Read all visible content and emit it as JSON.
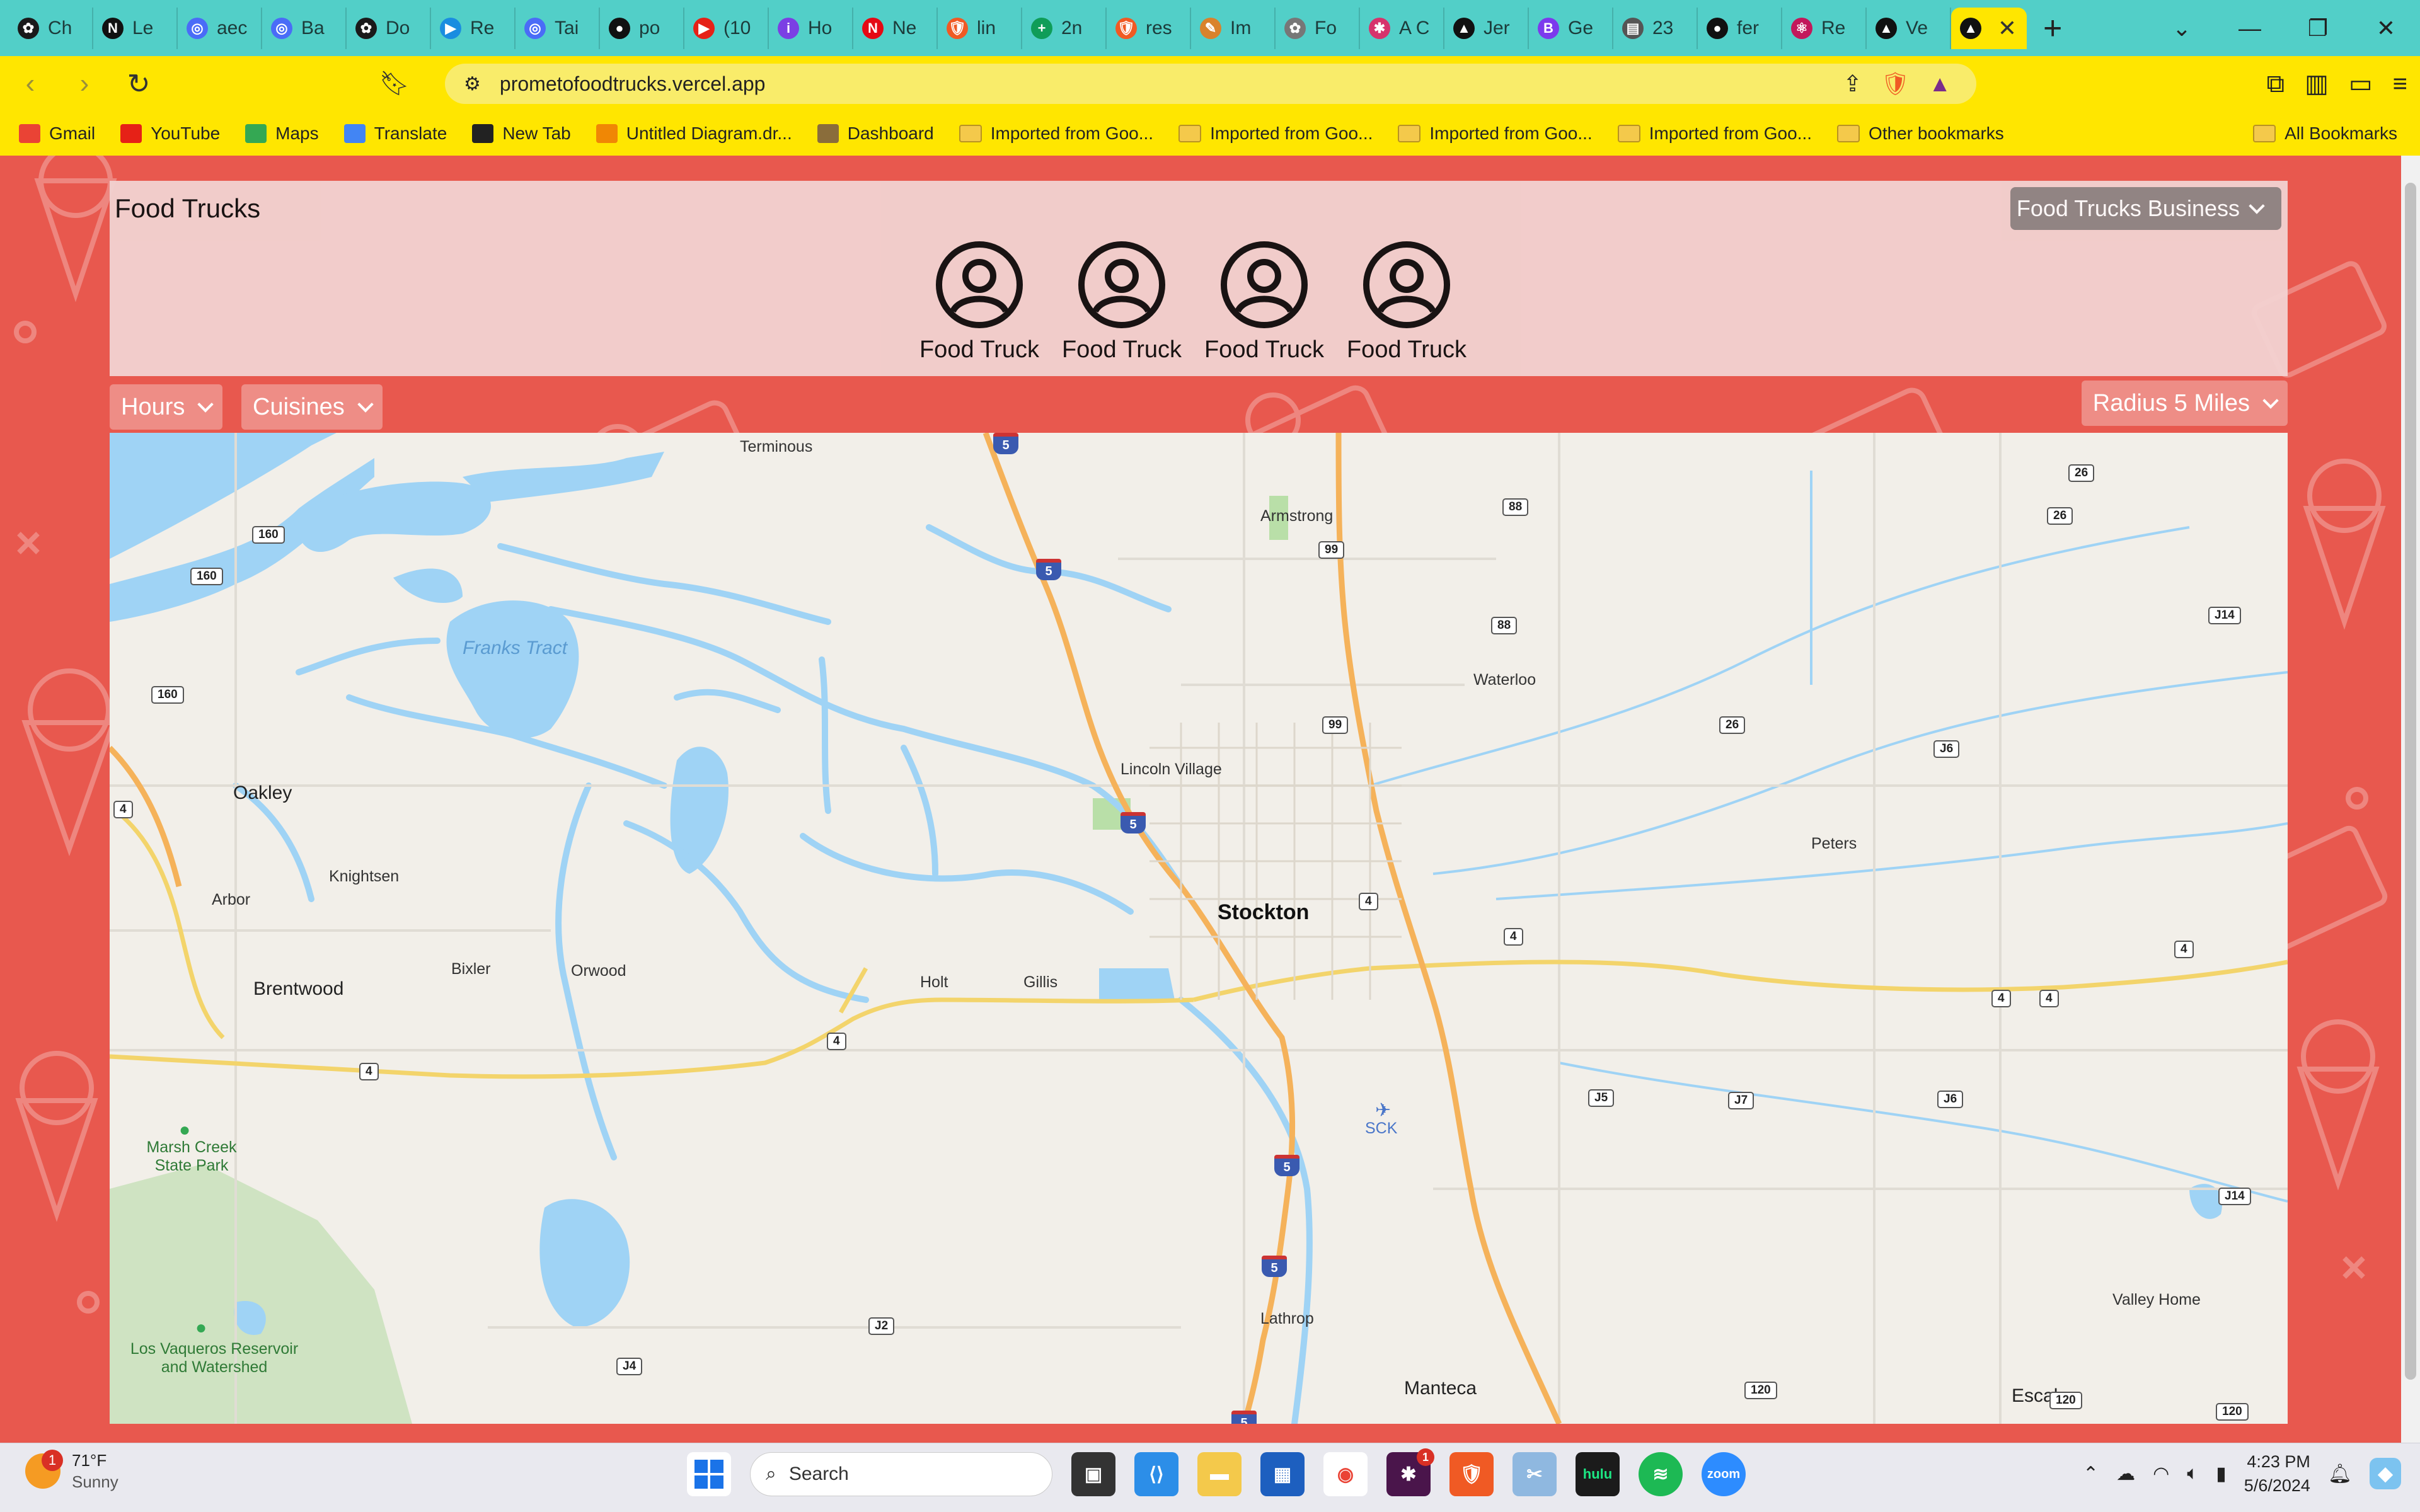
{
  "browser": {
    "tabs": [
      {
        "label": "Ch",
        "icon": "chatgpt-icon",
        "color": "#1a1a1a"
      },
      {
        "label": "Le",
        "icon": "notion-icon",
        "color": "#111111"
      },
      {
        "label": "aec",
        "icon": "chrome-icon",
        "color": "#4a6cf7"
      },
      {
        "label": "Ba",
        "icon": "chrome-icon",
        "color": "#4a6cf7"
      },
      {
        "label": "Do",
        "icon": "openai-icon",
        "color": "#1a1a1a"
      },
      {
        "label": "Re",
        "icon": "record-icon",
        "color": "#1a8de0"
      },
      {
        "label": "Tai",
        "icon": "chrome-icon",
        "color": "#4a6cf7"
      },
      {
        "label": "po",
        "icon": "github-icon",
        "color": "#111111"
      },
      {
        "label": "(10",
        "icon": "youtube-icon",
        "color": "#e62117"
      },
      {
        "label": "Ho",
        "icon": "info-icon",
        "color": "#7b3fe4"
      },
      {
        "label": "Ne",
        "icon": "netflix-icon",
        "color": "#e50914"
      },
      {
        "label": "lin",
        "icon": "brave-icon",
        "color": "#f05a24"
      },
      {
        "label": "2n",
        "icon": "sheets-icon",
        "color": "#0f9d58"
      },
      {
        "label": "res",
        "icon": "brave-icon",
        "color": "#f05a24"
      },
      {
        "label": "Im",
        "icon": "pen-icon",
        "color": "#d9822b"
      },
      {
        "label": "Fo",
        "icon": "openai-icon",
        "color": "#777777"
      },
      {
        "label": "A C",
        "icon": "asterisk-icon",
        "color": "#d6336c"
      },
      {
        "label": "Jer",
        "icon": "vercel-icon",
        "color": "#111111"
      },
      {
        "label": "Ge",
        "icon": "bold-b-icon",
        "color": "#7c3aed"
      },
      {
        "label": "23",
        "icon": "document-icon",
        "color": "#555555"
      },
      {
        "label": "fer",
        "icon": "github-icon",
        "color": "#111111"
      },
      {
        "label": "Re",
        "icon": "react-icon",
        "color": "#c2185b"
      },
      {
        "label": "Ve",
        "icon": "vercel-icon",
        "color": "#111111"
      }
    ],
    "active_tab_icon": "vercel-icon",
    "url": "prometofoodtrucks.vercel.app",
    "bookmarks": [
      {
        "label": "Gmail",
        "icon": "gmail-icon",
        "color": "#ea4335"
      },
      {
        "label": "YouTube",
        "icon": "youtube-icon",
        "color": "#e62117"
      },
      {
        "label": "Maps",
        "icon": "maps-icon",
        "color": "#34a853"
      },
      {
        "label": "Translate",
        "icon": "translate-icon",
        "color": "#4285f4"
      },
      {
        "label": "New Tab",
        "icon": "globe-icon",
        "color": "#222222"
      },
      {
        "label": "Untitled Diagram.dr...",
        "icon": "drawio-icon",
        "color": "#f08705"
      },
      {
        "label": "Dashboard",
        "icon": "dashboard-icon",
        "color": "#8a6d3b"
      },
      {
        "label": "Imported from Goo...",
        "icon": "folder-icon",
        "color": "#f4c94b"
      },
      {
        "label": "Imported from Goo...",
        "icon": "folder-icon",
        "color": "#f4c94b"
      },
      {
        "label": "Imported from Goo...",
        "icon": "folder-icon",
        "color": "#f4c94b"
      },
      {
        "label": "Imported from Goo...",
        "icon": "folder-icon",
        "color": "#f4c94b"
      },
      {
        "label": "Other bookmarks",
        "icon": "folder-icon",
        "color": "#f4c94b"
      }
    ],
    "all_bookmarks": "All Bookmarks",
    "accent_color": "#ffe600",
    "tabstrip_color": "#52cfc8"
  },
  "app": {
    "title": "Food Trucks",
    "business_button": "Food Trucks Business",
    "trucks": [
      {
        "label": "Food Truck"
      },
      {
        "label": "Food Truck"
      },
      {
        "label": "Food Truck"
      },
      {
        "label": "Food Truck"
      }
    ],
    "filters": {
      "hours": "Hours",
      "cuisines": "Cuisines",
      "radius": "Radius 5 Miles"
    },
    "background_color": "#e8584e"
  },
  "map": {
    "places": [
      {
        "label": "Terminous"
      },
      {
        "label": "Armstrong"
      },
      {
        "label": "Franks Tract"
      },
      {
        "label": "Waterloo"
      },
      {
        "label": "Lincoln Village"
      },
      {
        "label": "Oakley"
      },
      {
        "label": "Knightsen"
      },
      {
        "label": "Arbor"
      },
      {
        "label": "Brentwood"
      },
      {
        "label": "Bixler"
      },
      {
        "label": "Orwood"
      },
      {
        "label": "Holt"
      },
      {
        "label": "Gillis"
      },
      {
        "label": "Stockton"
      },
      {
        "label": "Peters"
      },
      {
        "label": "SCK"
      },
      {
        "label": "Marsh Creek State Park"
      },
      {
        "label": "Los Vaqueros Reservoir and Watershed"
      },
      {
        "label": "Lathrop"
      },
      {
        "label": "Manteca"
      },
      {
        "label": "Valley Home"
      },
      {
        "label": "Escalon"
      }
    ],
    "shields": [
      "160",
      "160",
      "160",
      "4",
      "88",
      "88",
      "99",
      "99",
      "26",
      "26",
      "26",
      "J14",
      "J6",
      "4",
      "4",
      "4",
      "4",
      "4",
      "4",
      "4",
      "J5",
      "J7",
      "J6",
      "J14",
      "J2",
      "J4",
      "120",
      "120",
      "120"
    ],
    "interstate": "5"
  },
  "taskbar": {
    "temperature": "71°F",
    "condition": "Sunny",
    "weather_badge": "1",
    "search_placeholder": "Search",
    "apps": [
      "windows-icon",
      "file-explorer-icon",
      "vscode-icon",
      "folder-icon",
      "store-icon",
      "chrome-icon",
      "slack-icon",
      "brave-icon",
      "snipping-icon",
      "hulu-icon",
      "spotify-icon",
      "zoom-icon"
    ],
    "slack_badge": "1",
    "hulu_label": "hulu",
    "zoom_label": "zoom",
    "time": "4:23 PM",
    "date": "5/6/2024"
  }
}
